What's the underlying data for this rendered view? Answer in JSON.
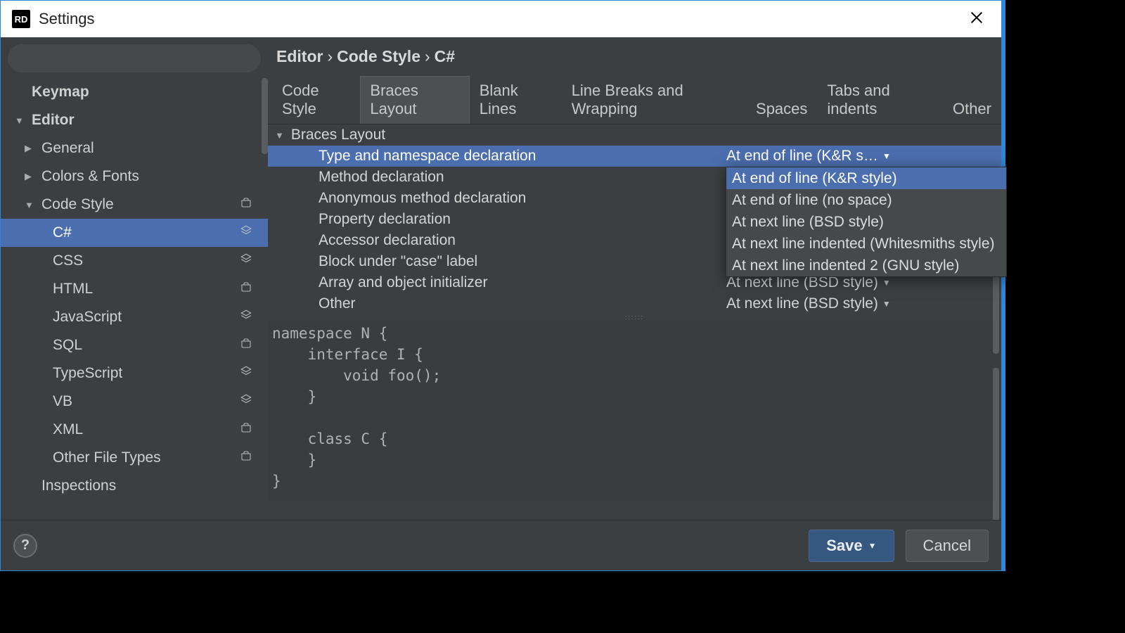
{
  "window": {
    "title": "Settings",
    "app_icon_label": "RD"
  },
  "search": {
    "placeholder": ""
  },
  "sidebar": {
    "items": [
      {
        "label": "Keymap",
        "indent": 0,
        "bold": true,
        "arrow": "",
        "icon": ""
      },
      {
        "label": "Editor",
        "indent": 0,
        "bold": true,
        "arrow": "down",
        "icon": ""
      },
      {
        "label": "General",
        "indent": 1,
        "bold": false,
        "arrow": "right",
        "icon": ""
      },
      {
        "label": "Colors & Fonts",
        "indent": 1,
        "bold": false,
        "arrow": "right",
        "icon": ""
      },
      {
        "label": "Code Style",
        "indent": 1,
        "bold": false,
        "arrow": "down",
        "icon": "scheme"
      },
      {
        "label": "C#",
        "indent": 2,
        "bold": false,
        "arrow": "",
        "icon": "layers",
        "selected": true
      },
      {
        "label": "CSS",
        "indent": 2,
        "bold": false,
        "arrow": "",
        "icon": "layers"
      },
      {
        "label": "HTML",
        "indent": 2,
        "bold": false,
        "arrow": "",
        "icon": "scheme"
      },
      {
        "label": "JavaScript",
        "indent": 2,
        "bold": false,
        "arrow": "",
        "icon": "layers"
      },
      {
        "label": "SQL",
        "indent": 2,
        "bold": false,
        "arrow": "",
        "icon": "scheme"
      },
      {
        "label": "TypeScript",
        "indent": 2,
        "bold": false,
        "arrow": "",
        "icon": "layers"
      },
      {
        "label": "VB",
        "indent": 2,
        "bold": false,
        "arrow": "",
        "icon": "layers"
      },
      {
        "label": "XML",
        "indent": 2,
        "bold": false,
        "arrow": "",
        "icon": "scheme"
      },
      {
        "label": "Other File Types",
        "indent": 2,
        "bold": false,
        "arrow": "",
        "icon": "scheme"
      },
      {
        "label": "Inspections",
        "indent": 1,
        "bold": false,
        "arrow": "",
        "icon": ""
      }
    ]
  },
  "breadcrumb": {
    "parts": [
      "Editor",
      "Code Style",
      "C#"
    ]
  },
  "tabs": [
    {
      "label": "Code Style"
    },
    {
      "label": "Braces Layout",
      "active": true
    },
    {
      "label": "Blank Lines"
    },
    {
      "label": "Line Breaks and Wrapping"
    },
    {
      "label": "Spaces"
    },
    {
      "label": "Tabs and indents"
    },
    {
      "label": "Other"
    }
  ],
  "section": {
    "title": "Braces Layout"
  },
  "options": [
    {
      "label": "Type and namespace declaration",
      "value": "At end of line (K&R s…",
      "selected": true
    },
    {
      "label": "Method declaration",
      "value": ""
    },
    {
      "label": "Anonymous method declaration",
      "value": ""
    },
    {
      "label": "Property declaration",
      "value": ""
    },
    {
      "label": "Accessor declaration",
      "value": ""
    },
    {
      "label": "Block under \"case\" label",
      "value": ""
    },
    {
      "label": "Array and object initializer",
      "value": "At next line (BSD style)"
    },
    {
      "label": "Other",
      "value": "At next line (BSD style)"
    }
  ],
  "dropdown": {
    "items": [
      {
        "label": "At end of line (K&R style)",
        "selected": true
      },
      {
        "label": "At end of line (no space)"
      },
      {
        "label": "At next line (BSD style)"
      },
      {
        "label": "At next line indented (Whitesmiths style)"
      },
      {
        "label": "At next line indented 2 (GNU style)"
      }
    ]
  },
  "code_preview": "namespace N {\n    interface I {\n        void foo();\n    }\n\n    class C {\n    }\n}",
  "footer": {
    "save_label": "Save",
    "cancel_label": "Cancel"
  }
}
